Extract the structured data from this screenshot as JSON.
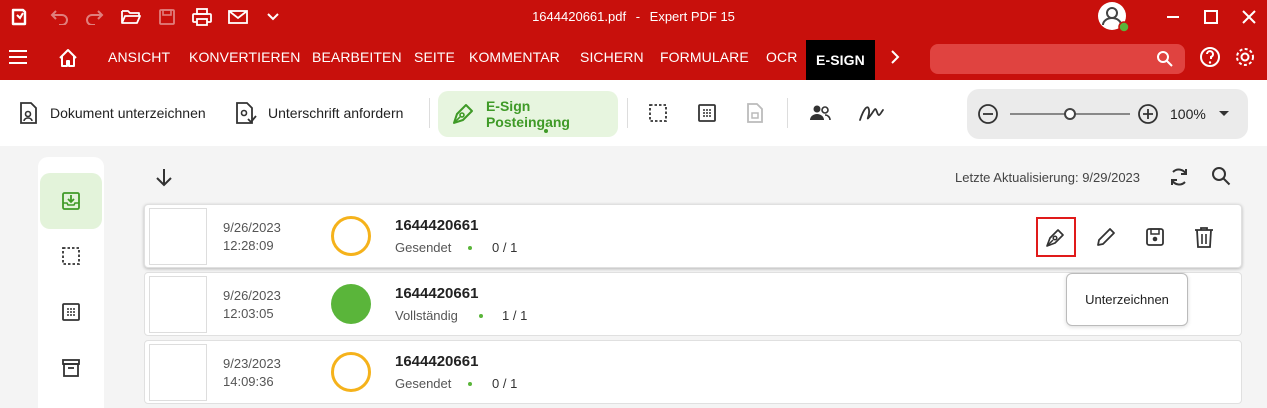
{
  "window": {
    "filename": "1644420661.pdf",
    "separator": "-",
    "app_name": "Expert PDF 15"
  },
  "menu": {
    "items": [
      "ANSICHT",
      "KONVERTIEREN",
      "BEARBEITEN",
      "SEITE",
      "KOMMENTAR",
      "SICHERN",
      "FORMULARE",
      "OCR"
    ],
    "active": "E-SIGN"
  },
  "ribbon": {
    "sign_document": "Dokument unterzeichnen",
    "request_signature": "Unterschrift anfordern",
    "inbox": "E-Sign Posteingang",
    "zoom": "100%"
  },
  "list": {
    "last_update": "Letzte Aktualisierung: 9/29/2023",
    "rows": [
      {
        "date": "9/26/2023",
        "time": "12:28:09",
        "name": "1644420661",
        "status": "Gesendet",
        "count": "0 / 1",
        "state": "open"
      },
      {
        "date": "9/26/2023",
        "time": "12:03:05",
        "name": "1644420661",
        "status": "Vollständig",
        "count": "1 / 1",
        "state": "done"
      },
      {
        "date": "9/23/2023",
        "time": "14:09:36",
        "name": "1644420661",
        "status": "Gesendet",
        "count": "0 / 1",
        "state": "open"
      }
    ]
  },
  "tooltip": {
    "text": "Unterzeichnen"
  },
  "colors": {
    "brand": "#c8100c",
    "accent_green": "#3f9a27",
    "pending": "#f5b21b",
    "complete": "#5ab53a"
  }
}
